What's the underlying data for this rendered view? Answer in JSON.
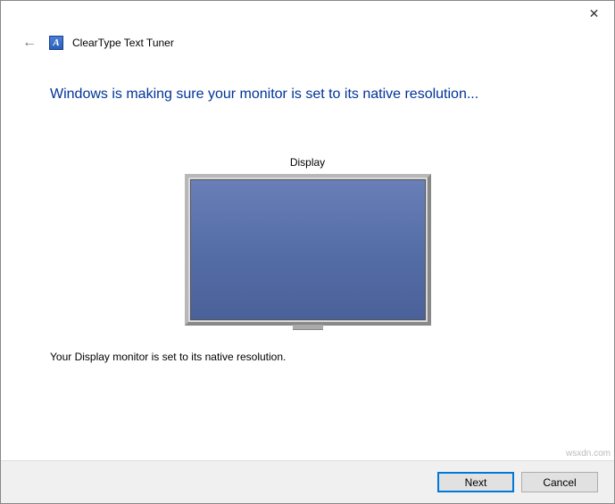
{
  "window": {
    "title": "ClearType Text Tuner",
    "close_label": "✕"
  },
  "header": {
    "back_symbol": "←",
    "app_icon_letter": "A"
  },
  "main": {
    "heading": "Windows is making sure your monitor is set to its native resolution...",
    "display_label": "Display",
    "status_text": "Your Display monitor is set to its native resolution."
  },
  "footer": {
    "next_label": "Next",
    "cancel_label": "Cancel"
  },
  "watermark": "wsxdn.com"
}
